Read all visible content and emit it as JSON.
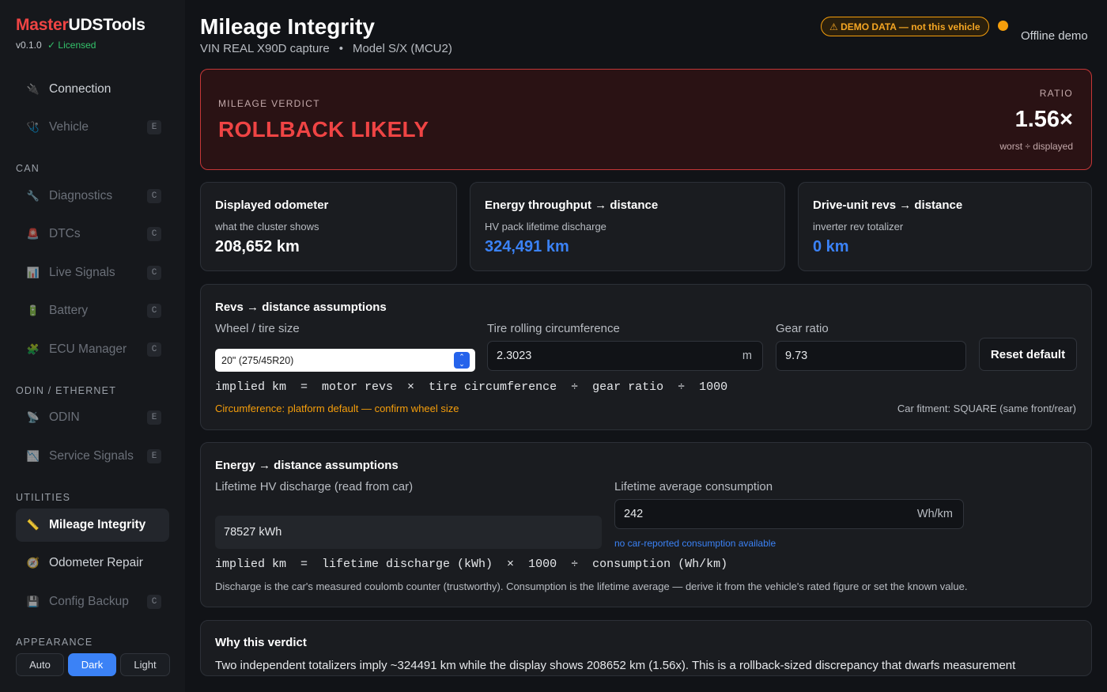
{
  "sidebar": {
    "brand_part1": "Master",
    "brand_part2": "UDSTools",
    "version": "v0.1.0",
    "license": "✓ Licensed",
    "items": [
      {
        "label": "Connection",
        "icon": "plug-icon",
        "badge": ""
      },
      {
        "label": "Vehicle",
        "icon": "stethoscope-icon",
        "badge": "E"
      },
      {
        "label": "Diagnostics",
        "icon": "wrench-icon",
        "badge": "C"
      },
      {
        "label": "DTCs",
        "icon": "alert-icon",
        "badge": "C"
      },
      {
        "label": "Live Signals",
        "icon": "chart-icon",
        "badge": "C"
      },
      {
        "label": "Battery",
        "icon": "battery-icon",
        "badge": "C"
      },
      {
        "label": "ECU Manager",
        "icon": "puzzle-icon",
        "badge": "C"
      },
      {
        "label": "ODIN",
        "icon": "satellite-icon",
        "badge": "E"
      },
      {
        "label": "Service Signals",
        "icon": "signal-chart-icon",
        "badge": "E"
      },
      {
        "label": "Mileage Integrity",
        "icon": "ruler-icon",
        "badge": ""
      },
      {
        "label": "Odometer Repair",
        "icon": "gauge-icon",
        "badge": ""
      },
      {
        "label": "Config Backup",
        "icon": "floppy-icon",
        "badge": "C"
      }
    ],
    "sections": {
      "can": "CAN",
      "odin": "ODIN / ETHERNET",
      "utilities": "UTILITIES",
      "appearance": "APPEARANCE"
    },
    "appearance_options": [
      "Auto",
      "Dark",
      "Light"
    ],
    "appearance_selected": "Dark"
  },
  "header": {
    "title": "Mileage Integrity",
    "vin": "VIN REAL X90D capture",
    "separator": "•",
    "model": "Model S/X (MCU2)",
    "demo_badge": "⚠ DEMO DATA — not this vehicle",
    "status_color": "#f59e0b",
    "status_text": "Offline demo"
  },
  "verdict": {
    "label": "MILEAGE VERDICT",
    "value": "ROLLBACK LIKELY",
    "ratio_label": "RATIO",
    "ratio_value": "1.56×",
    "ratio_note": "worst ÷ displayed"
  },
  "stats": [
    {
      "title": "Displayed odometer",
      "sub": "what the cluster shows",
      "value": "208,652 km"
    },
    {
      "title": "Energy throughput → distance",
      "sub": "HV pack lifetime discharge",
      "value": "324,491 km"
    },
    {
      "title": "Drive-unit revs → distance",
      "sub": "inverter rev totalizer",
      "value": "0 km"
    }
  ],
  "revs": {
    "heading": "Revs → distance assumptions",
    "wheel_label": "Wheel / tire size",
    "wheel_value": "20\" (275/45R20)",
    "circ_label": "Tire rolling circumference",
    "circ_value": "2.3023",
    "circ_unit": "m",
    "gear_label": "Gear ratio",
    "gear_value": "9.73",
    "reset_label": "Reset default",
    "formula": "implied km  =  motor revs  ×  tire circumference  ÷  gear ratio  ÷  1000",
    "warning": "Circumference: platform default — confirm wheel size",
    "fitment": "Car fitment: SQUARE (same front/rear)"
  },
  "energy": {
    "heading": "Energy → distance assumptions",
    "discharge_label": "Lifetime HV discharge (read from car)",
    "discharge_value": "78527 kWh",
    "consumption_label": "Lifetime average consumption",
    "consumption_value": "242",
    "consumption_unit": "Wh/km",
    "consumption_note": "no car-reported consumption available",
    "formula": "implied km  =  lifetime discharge (kWh)  ×  1000  ÷  consumption (Wh/km)",
    "note": "Discharge is the car's measured coulomb counter (trustworthy). Consumption is the lifetime average — derive it from the vehicle's rated figure or set the known value."
  },
  "why": {
    "heading": "Why this verdict",
    "text": "Two independent totalizers imply ~324491 km while the display shows 208652 km (1.56x). This is a rollback-sized discrepancy that dwarfs measurement uncertainty."
  }
}
